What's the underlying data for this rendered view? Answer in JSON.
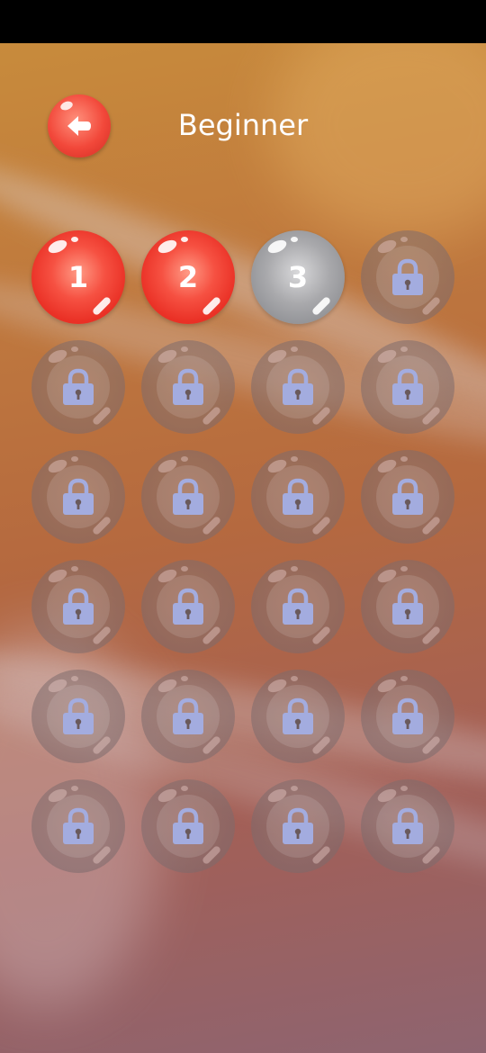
{
  "header": {
    "title": "Beginner"
  },
  "levels": [
    {
      "label": "1",
      "state": "completed"
    },
    {
      "label": "2",
      "state": "completed"
    },
    {
      "label": "3",
      "state": "current"
    },
    {
      "label": "",
      "state": "locked"
    },
    {
      "label": "",
      "state": "locked"
    },
    {
      "label": "",
      "state": "locked"
    },
    {
      "label": "",
      "state": "locked"
    },
    {
      "label": "",
      "state": "locked"
    },
    {
      "label": "",
      "state": "locked"
    },
    {
      "label": "",
      "state": "locked"
    },
    {
      "label": "",
      "state": "locked"
    },
    {
      "label": "",
      "state": "locked"
    },
    {
      "label": "",
      "state": "locked"
    },
    {
      "label": "",
      "state": "locked"
    },
    {
      "label": "",
      "state": "locked"
    },
    {
      "label": "",
      "state": "locked"
    },
    {
      "label": "",
      "state": "locked"
    },
    {
      "label": "",
      "state": "locked"
    },
    {
      "label": "",
      "state": "locked"
    },
    {
      "label": "",
      "state": "locked"
    },
    {
      "label": "",
      "state": "locked"
    },
    {
      "label": "",
      "state": "locked"
    },
    {
      "label": "",
      "state": "locked"
    },
    {
      "label": "",
      "state": "locked"
    }
  ],
  "icons": {
    "back": "back-arrow-icon",
    "lock": "lock-icon"
  },
  "colors": {
    "completed": "#f2483a",
    "current": "#9a9b9f",
    "lock_icon": "#a3acdf"
  }
}
